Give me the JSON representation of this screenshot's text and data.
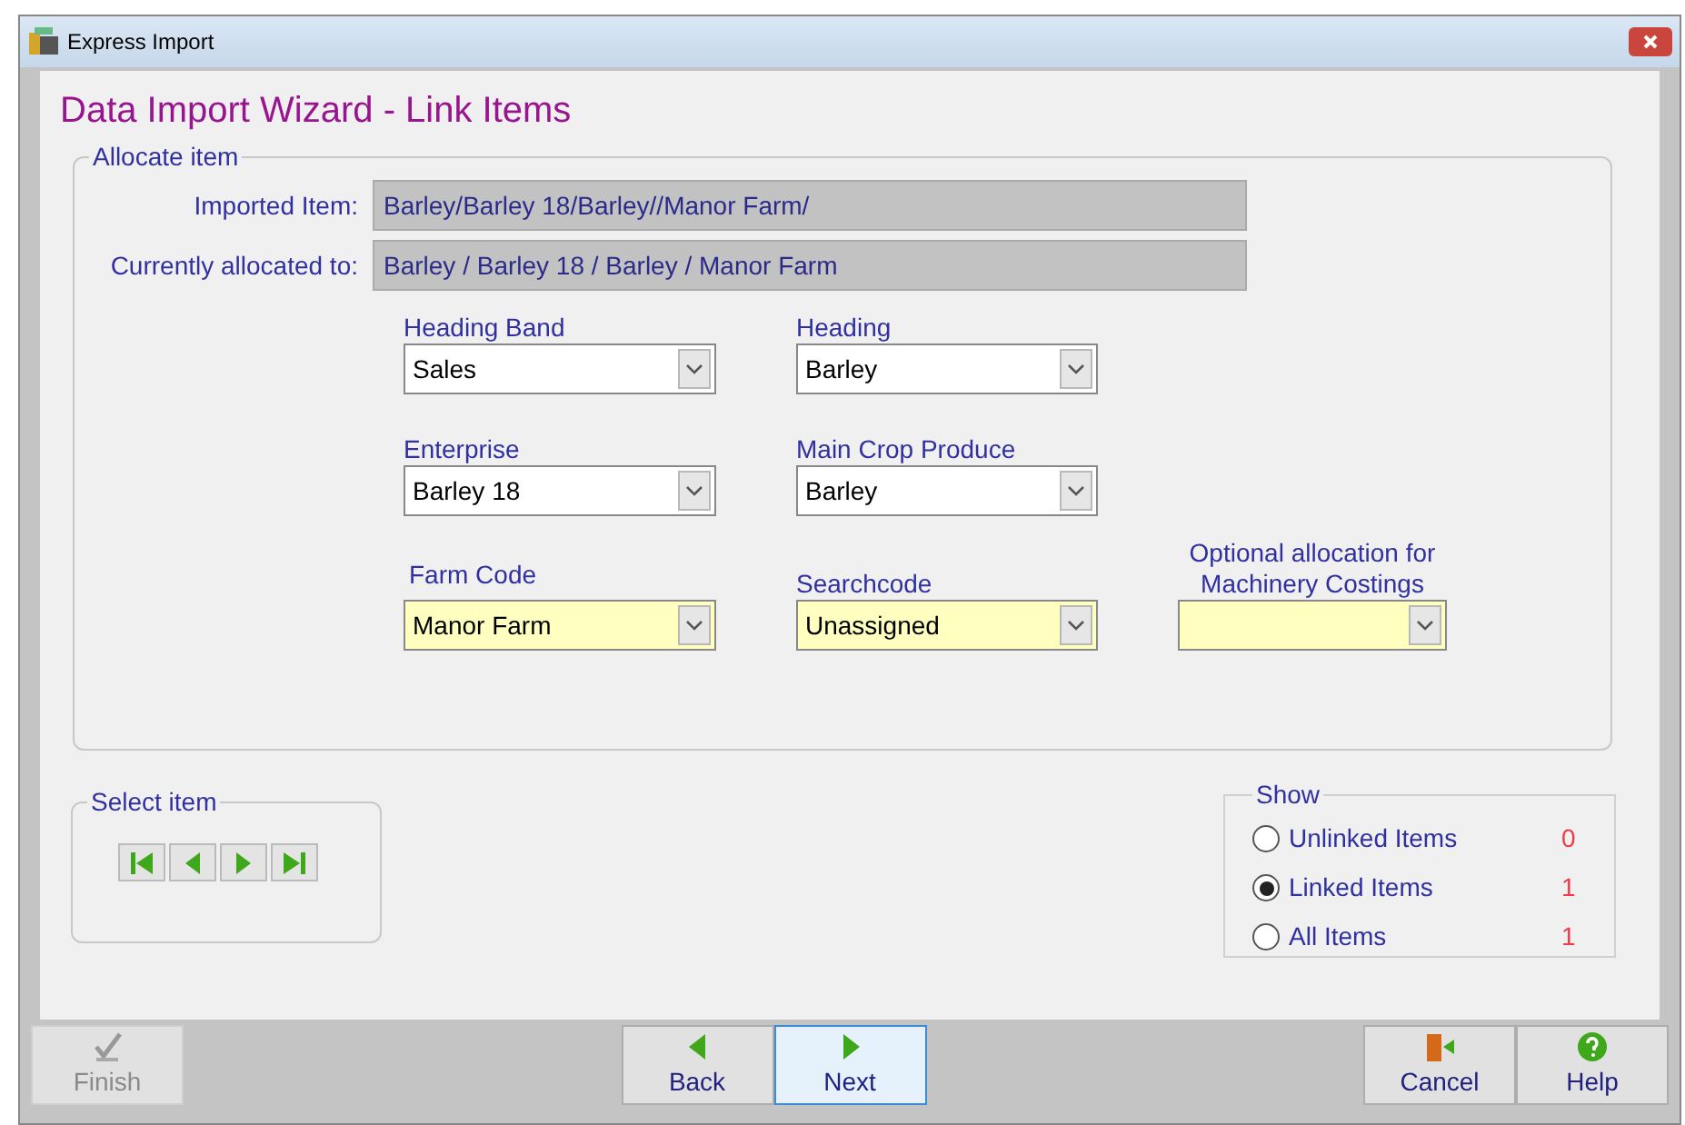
{
  "window": {
    "title": "Express Import"
  },
  "heading": "Data Import Wizard - Link Items",
  "allocate": {
    "title": "Allocate item",
    "info": [
      {
        "label": "Imported Item:",
        "value": "Barley/Barley 18/Barley//Manor Farm/"
      },
      {
        "label": "Currently allocated to:",
        "value": "Barley / Barley 18 / Barley / Manor Farm"
      }
    ],
    "combos": [
      {
        "label": "Heading Band",
        "value": "Sales",
        "highlighted": false
      },
      {
        "label": "Heading",
        "value": "Barley",
        "highlighted": false
      },
      {
        "label": "Enterprise",
        "value": "Barley 18",
        "highlighted": false
      },
      {
        "label": "Main Crop Produce",
        "value": "Barley",
        "highlighted": false
      },
      {
        "label": "Farm Code",
        "value": "Manor Farm",
        "highlighted": true
      },
      {
        "label": "Searchcode",
        "value": "Unassigned",
        "highlighted": true
      },
      {
        "label": "Optional allocation for Machinery Costings",
        "highlighted": true
      }
    ]
  },
  "select_item": {
    "title": "Select item"
  },
  "show": {
    "title": "Show",
    "options": [
      {
        "label": "Unlinked Items",
        "count": "0",
        "selected": false
      },
      {
        "label": "Linked Items",
        "count": "1",
        "selected": true
      },
      {
        "label": "All Items",
        "count": "1",
        "selected": false
      }
    ]
  },
  "buttons": [
    {
      "label": "Finish",
      "kind": "finish",
      "disabled": true,
      "selected": false
    },
    {
      "label": "Back",
      "kind": "back",
      "disabled": false,
      "selected": false
    },
    {
      "label": "Next",
      "kind": "next",
      "disabled": false,
      "selected": true
    },
    {
      "label": "Cancel",
      "kind": "cancel",
      "disabled": false,
      "selected": false
    },
    {
      "label": "Help",
      "kind": "help",
      "disabled": false,
      "selected": false
    }
  ]
}
